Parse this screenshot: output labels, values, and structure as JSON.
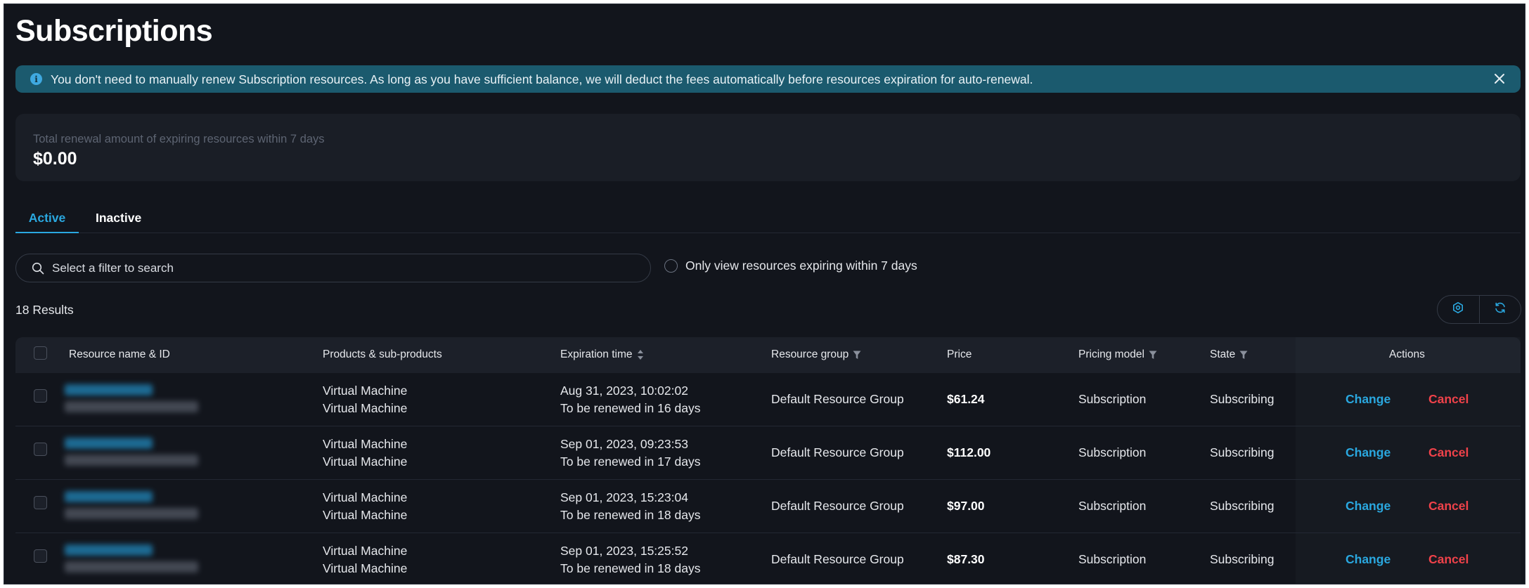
{
  "page": {
    "title": "Subscriptions"
  },
  "banner": {
    "text": "You don't need to manually renew Subscription resources. As long as you have sufficient balance, we will deduct the fees automatically before resources expiration for auto-renewal.",
    "icon": "info-icon",
    "color": "#1b5a6e"
  },
  "summary": {
    "label": "Total renewal amount of expiring resources within 7 days",
    "amount": "$0.00"
  },
  "tabs": [
    {
      "label": "Active",
      "active": true
    },
    {
      "label": "Inactive",
      "active": false
    }
  ],
  "search": {
    "placeholder": "Select a filter to search",
    "value": ""
  },
  "filter_toggle": {
    "label": "Only view resources expiring within 7 days",
    "checked": false
  },
  "results": {
    "label": "18 Results"
  },
  "toolbar": {
    "icons": [
      "settings-icon",
      "refresh-icon"
    ]
  },
  "table": {
    "headers": {
      "name": "Resource name & ID",
      "products": "Products & sub-products",
      "expiration": "Expiration time",
      "group": "Resource group",
      "price": "Price",
      "pricing_model": "Pricing model",
      "state": "State",
      "actions": "Actions"
    },
    "rows": [
      {
        "product": "Virtual Machine",
        "sub_product": "Virtual Machine",
        "expiration": "Aug 31, 2023, 10:02:02",
        "renewal": "To be renewed in 16 days",
        "group": "Default Resource Group",
        "price": "$61.24",
        "pricing_model": "Subscription",
        "state": "Subscribing",
        "change_label": "Change",
        "cancel_label": "Cancel"
      },
      {
        "product": "Virtual Machine",
        "sub_product": "Virtual Machine",
        "expiration": "Sep 01, 2023, 09:23:53",
        "renewal": "To be renewed in 17 days",
        "group": "Default Resource Group",
        "price": "$112.00",
        "pricing_model": "Subscription",
        "state": "Subscribing",
        "change_label": "Change",
        "cancel_label": "Cancel"
      },
      {
        "product": "Virtual Machine",
        "sub_product": "Virtual Machine",
        "expiration": "Sep 01, 2023, 15:23:04",
        "renewal": "To be renewed in 18 days",
        "group": "Default Resource Group",
        "price": "$97.00",
        "pricing_model": "Subscription",
        "state": "Subscribing",
        "change_label": "Change",
        "cancel_label": "Cancel"
      },
      {
        "product": "Virtual Machine",
        "sub_product": "Virtual Machine",
        "expiration": "Sep 01, 2023, 15:25:52",
        "renewal": "To be renewed in 18 days",
        "group": "Default Resource Group",
        "price": "$87.30",
        "pricing_model": "Subscription",
        "state": "Subscribing",
        "change_label": "Change",
        "cancel_label": "Cancel"
      }
    ]
  },
  "colors": {
    "accent": "#2aa8e0",
    "danger": "#f0424a",
    "background": "#12151c"
  }
}
